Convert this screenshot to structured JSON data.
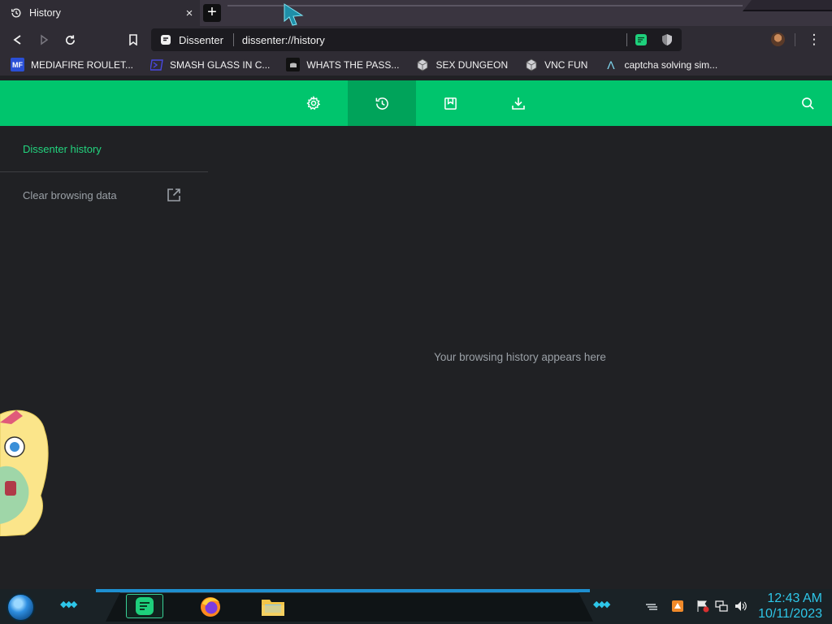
{
  "tab": {
    "title": "History",
    "close": "×"
  },
  "new_tab": "+",
  "omnibox": {
    "site_name": "Dissenter",
    "url": "dissenter://history"
  },
  "menu": "⋮",
  "bookmarks": [
    {
      "label": "MEDIAFIRE ROULET...",
      "icon": "mediafire-icon",
      "icon_text": "MF",
      "color": "#2a4fd6"
    },
    {
      "label": "SMASH GLASS IN C...",
      "icon": "powershell-icon",
      "icon_text": "",
      "color": "#3b3bd8"
    },
    {
      "label": "WHATS THE PASS...",
      "icon": "dark-site-icon",
      "icon_text": "",
      "color": "#111111"
    },
    {
      "label": "SEX DUNGEON",
      "icon": "cube-icon",
      "icon_text": "",
      "color": "#c8c8c8"
    },
    {
      "label": "VNC FUN",
      "icon": "cube-icon",
      "icon_text": "",
      "color": "#c8c8c8"
    },
    {
      "label": "captcha solving sim...",
      "icon": "lambda-icon",
      "icon_text": "Λ",
      "color": "#7fd8f0"
    }
  ],
  "header": {
    "buttons": [
      {
        "name": "settings-icon",
        "active": false
      },
      {
        "name": "history-icon",
        "active": true
      },
      {
        "name": "bookmarks-icon",
        "active": false
      },
      {
        "name": "downloads-icon",
        "active": false
      }
    ],
    "accent": "#00c56d",
    "accent_active": "#00a35a"
  },
  "sidebar": {
    "title": "Dissenter history",
    "clear_label": "Clear browsing data"
  },
  "main": {
    "empty_message": "Your browsing history appears here"
  },
  "taskbar": {
    "time": "12:43 AM",
    "date": "10/11/2023"
  }
}
